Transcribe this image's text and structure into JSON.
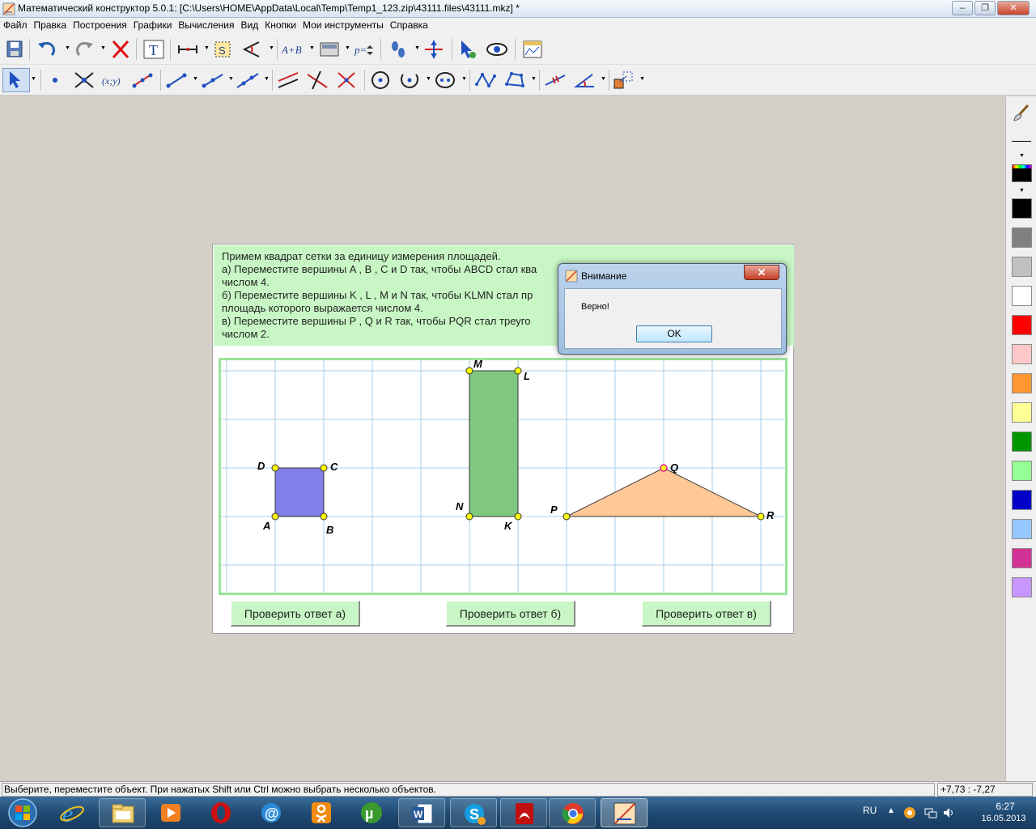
{
  "window": {
    "title": "Математический конструктор 5.0.1: [C:\\Users\\HOME\\AppData\\Local\\Temp\\Temp1_123.zip\\43111.files\\43111.mkz] *"
  },
  "menu": {
    "items": [
      "Файл",
      "Правка",
      "Построения",
      "Графики",
      "Вычисления",
      "Вид",
      "Кнопки",
      "Мои инструменты",
      "Справка"
    ]
  },
  "toolbar": {
    "text_tool_label": "T",
    "segment_label_tool": "S",
    "sum_tool_label": "A+B",
    "param_tool_label": "p=",
    "coord_tool_label": "(x;y)"
  },
  "task": {
    "line1": "Примем квадрат сетки за единицу измерения площадей.",
    "line2": "а) Переместите вершины A , B , C и D так, чтобы ABCD стал ква",
    "line3": "числом 4.",
    "line4": "б) Переместите вершины K , L , M и N так, чтобы KLMN стал пр",
    "line5": "площадь которого выражается числом 4.",
    "line6": "в) Переместите вершины P , Q и R так, чтобы PQR стал треуго",
    "line7": "числом 2."
  },
  "figures": {
    "square": {
      "A": "A",
      "B": "B",
      "C": "C",
      "D": "D",
      "color": "#8080e8"
    },
    "rectangle": {
      "K": "K",
      "L": "L",
      "M": "M",
      "N": "N",
      "color": "#80c880"
    },
    "triangle": {
      "P": "P",
      "Q": "Q",
      "R": "R",
      "color": "#ffc896"
    }
  },
  "buttons": {
    "check_a": "Проверить ответ а)",
    "check_b": "Проверить ответ б)",
    "check_c": "Проверить ответ в)"
  },
  "dialog": {
    "title": "Внимание",
    "message": "Верно!",
    "ok": "OK",
    "close": "✕"
  },
  "status": {
    "hint": "Выберите, переместите объект. При нажатых Shift или Ctrl можно выбрать несколько объектов.",
    "coords": "+7,73 : -7,27"
  },
  "palette": {
    "colors": [
      "#000000",
      "#808080",
      "#c0c0c0",
      "#ffffff",
      "#ff0000",
      "#ffc8c8",
      "#ff9632",
      "#ffff96",
      "#009600",
      "#96ff96",
      "#0000c8",
      "#96c8ff",
      "#d23296",
      "#c896ff"
    ]
  },
  "taskbar": {
    "lang": "RU",
    "time": "6:27",
    "date": "16.05.2013",
    "apps": [
      "internet-explorer",
      "explorer",
      "media-player",
      "opera",
      "mail",
      "odnoklassniki",
      "utorrent",
      "word",
      "skype",
      "pdf-reader",
      "chrome",
      "math-constructor"
    ]
  }
}
